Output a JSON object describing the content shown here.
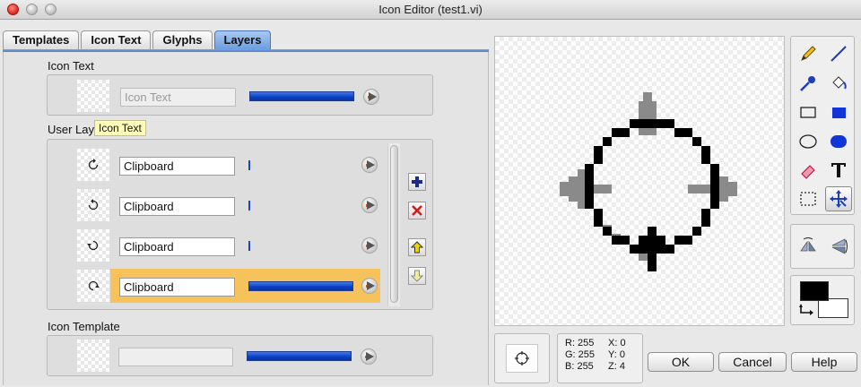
{
  "window": {
    "title": "Icon Editor (test1.vi)"
  },
  "tabs": [
    {
      "label": "Templates"
    },
    {
      "label": "Icon Text"
    },
    {
      "label": "Glyphs"
    },
    {
      "label": "Layers",
      "active": true
    }
  ],
  "icon_text_section": {
    "heading": "Icon Text",
    "placeholder": "Icon Text",
    "opacity": 1.0
  },
  "user_layers_section": {
    "heading": "User Lay",
    "tooltip": "Icon Text",
    "layers": [
      {
        "name": "Clipboard",
        "icon": "rotate-ccw-icon",
        "opacity": 0.0,
        "selected": false
      },
      {
        "name": "Clipboard",
        "icon": "rotate-cw-icon",
        "opacity": 0.0,
        "selected": false
      },
      {
        "name": "Clipboard",
        "icon": "rotate-cw-top-icon",
        "opacity": 0.0,
        "selected": false
      },
      {
        "name": "Clipboard",
        "icon": "rotate-cw-bottom-icon",
        "opacity": 1.0,
        "selected": true
      }
    ],
    "highlight_color": "#f6c25c"
  },
  "icon_template_section": {
    "heading": "Icon Template",
    "value": "",
    "opacity": 1.0
  },
  "tools": [
    "pencil-icon",
    "line-icon",
    "dropper-icon",
    "fill-bucket-icon",
    "rectangle-icon",
    "filled-rectangle-icon",
    "ellipse-icon",
    "filled-ellipse-icon",
    "eraser-icon",
    "text-icon",
    "selection-icon",
    "move-icon"
  ],
  "selected_tool": "move-icon",
  "flip_tools": [
    "flip-horizontal-icon",
    "flip-vertical-icon"
  ],
  "colors": {
    "foreground": "#000000",
    "background": "#ffffff",
    "accent": "#4b79c8"
  },
  "readout": {
    "r": "R: 255",
    "g": "G: 255",
    "b": "B: 255",
    "x": "X: 0",
    "y": "Y: 0",
    "z": "Z: 4"
  },
  "buttons": {
    "ok": "OK",
    "cancel": "Cancel",
    "help": "Help"
  }
}
